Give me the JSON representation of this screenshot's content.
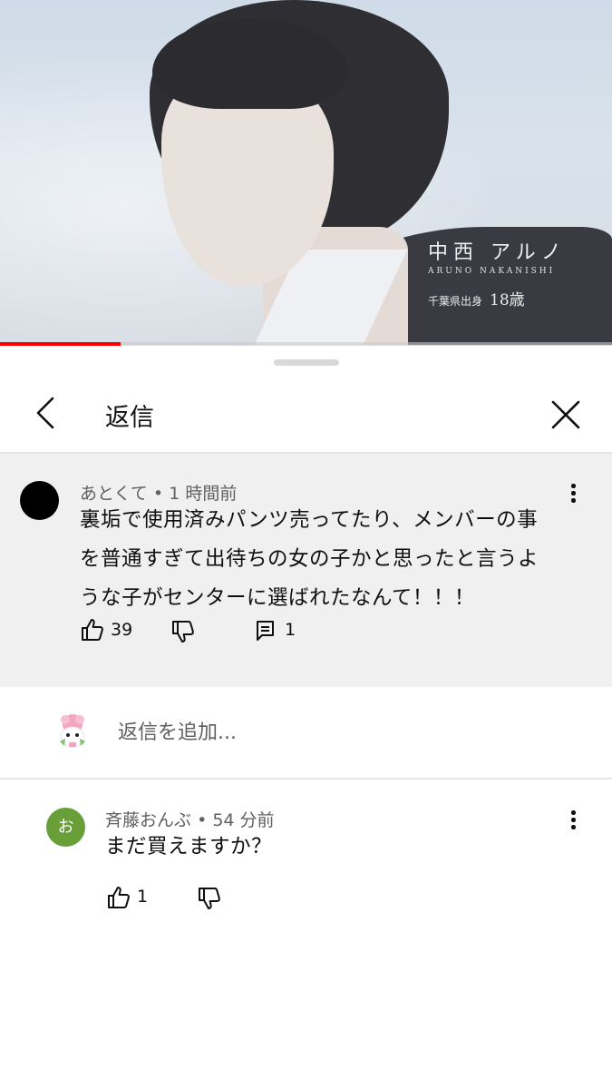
{
  "video": {
    "caption_name": "中西 アルノ",
    "caption_roman": "ARUNO NAKANISHI",
    "caption_origin": "千葉県出身",
    "caption_age": "18歳",
    "progress_percent": 19.7,
    "progress_color": "#ff0000"
  },
  "header": {
    "title": "返信",
    "back_icon": "chevron-left-icon",
    "close_icon": "close-icon"
  },
  "parent_comment": {
    "author": "あとくて",
    "separator": "•",
    "time": "1 時間前",
    "lines": [
      "裏垢で使用済みパンツ売ってたり、メンバーの事",
      "を普通すぎて出待ちの女の子かと思ったと言うよ",
      "うな子がセンターに選ばれたなんて！！！"
    ],
    "likes": "39",
    "replies": "1",
    "avatar_color": "#000000",
    "background": "#f0f0f0"
  },
  "add_reply": {
    "placeholder": "返信を追加..."
  },
  "reply": {
    "author": "斉藤おんぶ",
    "separator": "•",
    "time": "54 分前",
    "avatar_letter": "お",
    "avatar_color": "#689f38",
    "text": "まだ買えますか？",
    "likes": "1"
  }
}
